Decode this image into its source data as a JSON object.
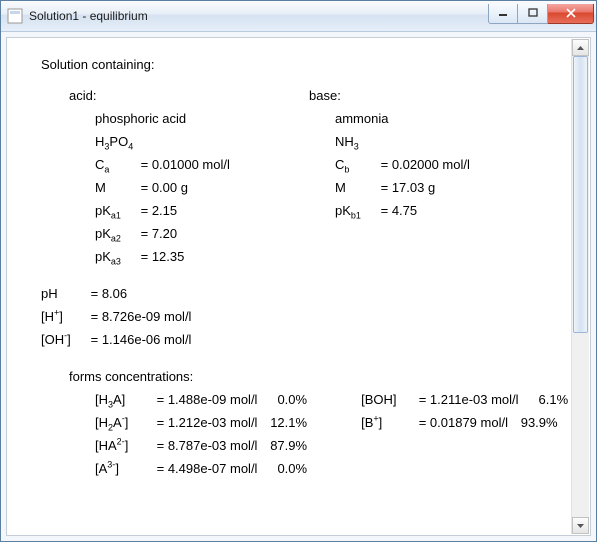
{
  "window": {
    "title": "Solution1 - equilibrium"
  },
  "heading": "Solution containing:",
  "acid": {
    "label": "acid:",
    "name": "phosphoric acid",
    "formula_html": "H<sub>3</sub>PO<sub>4</sub>",
    "Ca_label_html": "C<sub>a</sub>",
    "Ca": "= 0.01000 mol/l",
    "M_label": "M",
    "M": "= 0.00 g",
    "pKa1_label_html": "pK<sub>a1</sub>",
    "pKa1": "= 2.15",
    "pKa2_label_html": "pK<sub>a2</sub>",
    "pKa2": "= 7.20",
    "pKa3_label_html": "pK<sub>a3</sub>",
    "pKa3": "= 12.35"
  },
  "base": {
    "label": "base:",
    "name": "ammonia",
    "formula_html": "NH<sub>3</sub>",
    "Cb_label_html": "C<sub>b</sub>",
    "Cb": "= 0.02000 mol/l",
    "M_label": "M",
    "M": "= 17.03 g",
    "pKb1_label_html": "pK<sub>b1</sub>",
    "pKb1": "= 4.75"
  },
  "results": {
    "pH_label": "pH",
    "pH": "= 8.06",
    "H_label_html": "[H<sup>+</sup>]",
    "H": "= 8.726e-09 mol/l",
    "OH_label_html": "[OH<sup>-</sup>]",
    "OH": "= 1.146e-06 mol/l"
  },
  "forms": {
    "heading": "forms concentrations:",
    "acid": [
      {
        "label_html": "[H<sub>3</sub>A]",
        "val": "= 1.488e-09 mol/l",
        "pct": "0.0%"
      },
      {
        "label_html": "[H<sub>2</sub>A<sup>-</sup>]",
        "val": "= 1.212e-03 mol/l",
        "pct": "12.1%"
      },
      {
        "label_html": "[HA<sup>2-</sup>]",
        "val": "= 8.787e-03 mol/l",
        "pct": "87.9%"
      },
      {
        "label_html": "[A<sup>3-</sup>]",
        "val": "= 4.498e-07 mol/l",
        "pct": "0.0%"
      }
    ],
    "base": [
      {
        "label_html": "[BOH]",
        "val": "= 1.211e-03 mol/l",
        "pct": "6.1%"
      },
      {
        "label_html": "[B<sup>+</sup>]",
        "val": "= 0.01879 mol/l",
        "pct": "93.9%"
      }
    ]
  }
}
